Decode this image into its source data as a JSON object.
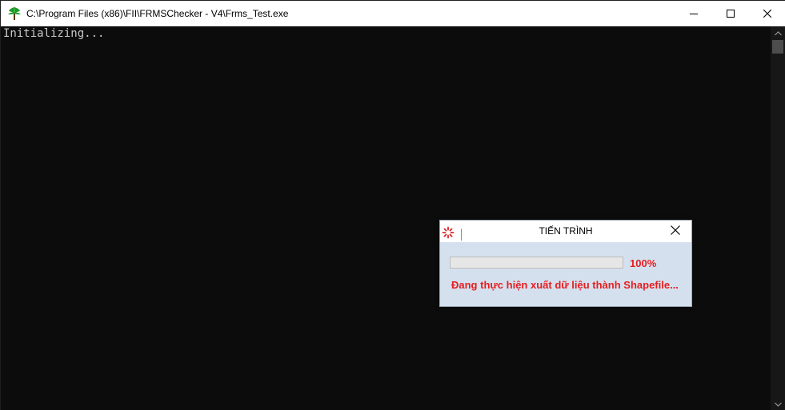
{
  "window": {
    "title": "C:\\Program Files (x86)\\FII\\FRMSChecker - V4\\Frms_Test.exe",
    "icon": "tree-icon",
    "controls": [
      "minimize-icon",
      "maximize-icon",
      "close-icon"
    ]
  },
  "console": {
    "lines": [
      "Initializing..."
    ],
    "background": "#0c0c0c",
    "text_color": "#cccccc"
  },
  "dialog": {
    "title": "TIẾN TRÌNH",
    "icon": "spinner-icon",
    "progress": {
      "percent_label": "100%",
      "fraction": 1.0
    },
    "status": "Đang thực hiện xuất dữ liệu thành Shapefile...",
    "accent_color": "#e61e1e",
    "background": "#d5e0ef"
  }
}
